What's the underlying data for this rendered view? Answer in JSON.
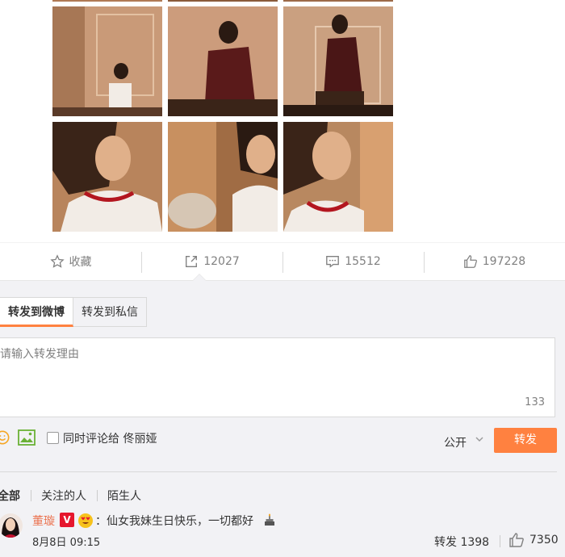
{
  "actions": {
    "favorite": "收藏",
    "repost": "12027",
    "comment": "15512",
    "like": "197228"
  },
  "repost_panel": {
    "tabs": [
      "转发到微博",
      "转发到私信"
    ],
    "placeholder": "请输入转发理由",
    "char_count": "133",
    "checkbox_label": "同时评论给 佟丽娅",
    "visibility": "公开",
    "send_label": "转发"
  },
  "filters": [
    "全部",
    "关注的人",
    "陌生人"
  ],
  "repost_item": {
    "user": "董璇",
    "content": "：仙女我妹生日快乐，一切都好",
    "time": "8月8日 09:15",
    "repost_label": "转发 1398",
    "like_count": "7350"
  },
  "colors": {
    "accent": "#ff8140",
    "username": "#eb7350",
    "panel_bg": "#f2f2f5"
  }
}
